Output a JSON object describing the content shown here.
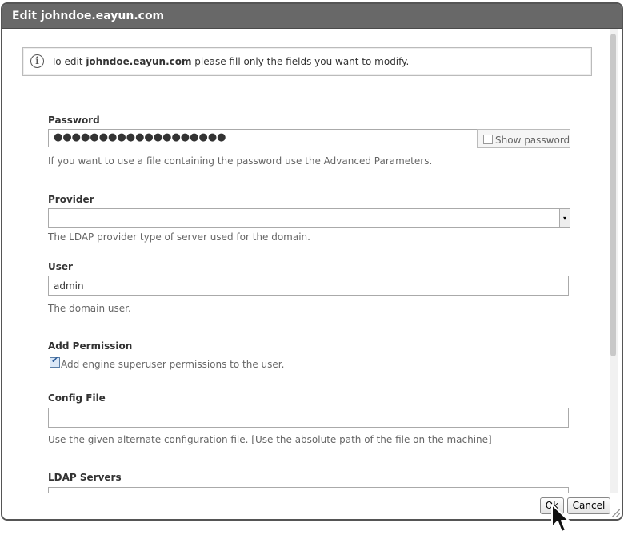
{
  "dialog": {
    "title": "Edit johndoe.eayun.com"
  },
  "info": {
    "prefix": "To edit ",
    "domain": "johndoe.eayun.com",
    "suffix": " please fill only the fields you want to modify."
  },
  "password": {
    "label": "Password",
    "masked_value": "●●●●●●●●●●●●●●●●●●●",
    "show_password_label": "Show password",
    "show_password_checked": false,
    "help": "If you want to use a file containing the password use the Advanced Parameters."
  },
  "provider": {
    "label": "Provider",
    "value": "",
    "help": "The LDAP provider type of server used for the domain."
  },
  "user": {
    "label": "User",
    "value": "admin",
    "help": "The domain user."
  },
  "permission": {
    "label": "Add Permission",
    "checkbox_label": "Add engine superuser permissions to the user.",
    "checked": true
  },
  "config_file": {
    "label": "Config File",
    "value": "",
    "help": "Use the given alternate configuration file. [Use the absolute path of the file on the machine]"
  },
  "ldap_servers": {
    "label": "LDAP Servers",
    "value": ""
  },
  "buttons": {
    "ok": "Ok",
    "cancel": "Cancel"
  }
}
